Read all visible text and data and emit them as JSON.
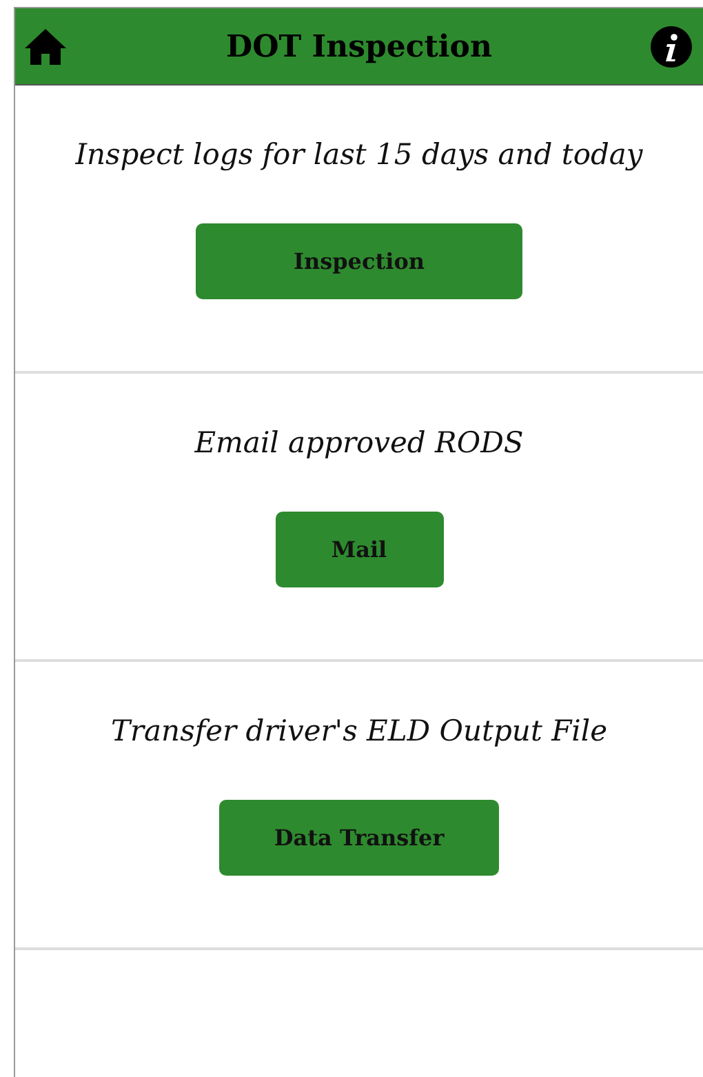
{
  "header": {
    "title": "DOT Inspection"
  },
  "sections": [
    {
      "text": "Inspect logs for last 15 days and today",
      "button": "Inspection"
    },
    {
      "text": "Email approved RODS",
      "button": "Mail"
    },
    {
      "text": "Transfer driver's ELD Output File",
      "button": "Data Transfer"
    }
  ]
}
